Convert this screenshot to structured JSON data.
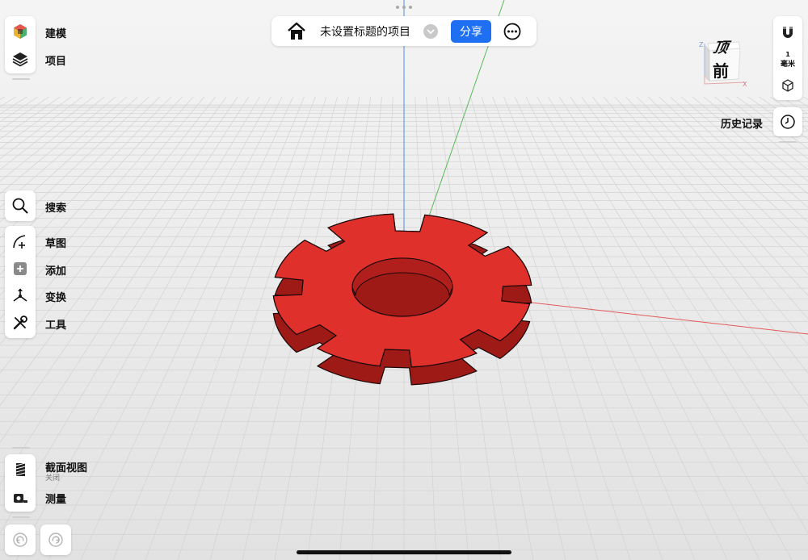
{
  "topbar": {
    "title": "未设置标题的项目",
    "share_label": "分享"
  },
  "left_top": {
    "modeling_label": "建模",
    "project_label": "项目"
  },
  "left_tools": {
    "search_label": "搜索",
    "sketch_label": "草图",
    "add_label": "添加",
    "transform_label": "变换",
    "tools_label": "工具"
  },
  "left_bottom": {
    "section_view_label": "截面视图",
    "section_view_status": "关闭",
    "measure_label": "测量"
  },
  "right": {
    "view_cube": {
      "top_face": "顶",
      "front_face": "前",
      "axis_z": "Z",
      "axis_x": "X"
    },
    "units_value": "1",
    "units_label": "毫米",
    "history_label": "历史记录"
  },
  "model": {
    "color": "#e0302c",
    "edge_color": "#1a0808"
  },
  "colors": {
    "accent": "#1e6ff1",
    "x_axis": "#e45b5b",
    "y_axis": "#5cb85c",
    "z_axis": "#4d8fe0"
  }
}
